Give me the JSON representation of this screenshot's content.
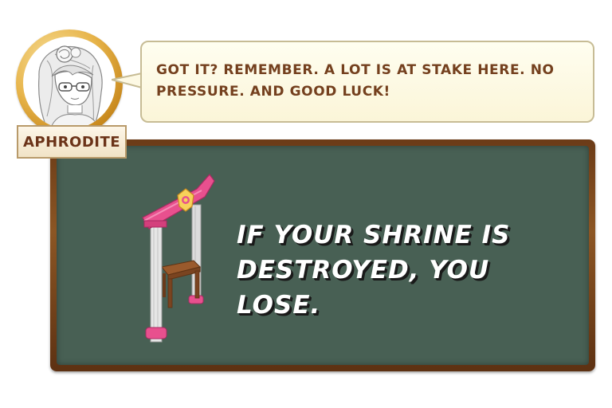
{
  "speaker": {
    "name": "APHRODITE"
  },
  "dialogue": {
    "text": "GOT IT? REMEMBER. A LOT IS AT STAKE HERE. NO PRESSURE. AND GOOD LUCK!"
  },
  "tutorial": {
    "text": "IF YOUR SHRINE IS DESTROYED, YOU LOSE.",
    "image": "shrine-icon"
  },
  "colors": {
    "portrait_ring": "#e7b44a",
    "name_text": "#6b3318",
    "bubble_bg": "#fdf9e4",
    "dialogue_text": "#74401e",
    "board_frame": "#7a4620",
    "board": "#486054",
    "shrine_pink": "#e8508e"
  }
}
